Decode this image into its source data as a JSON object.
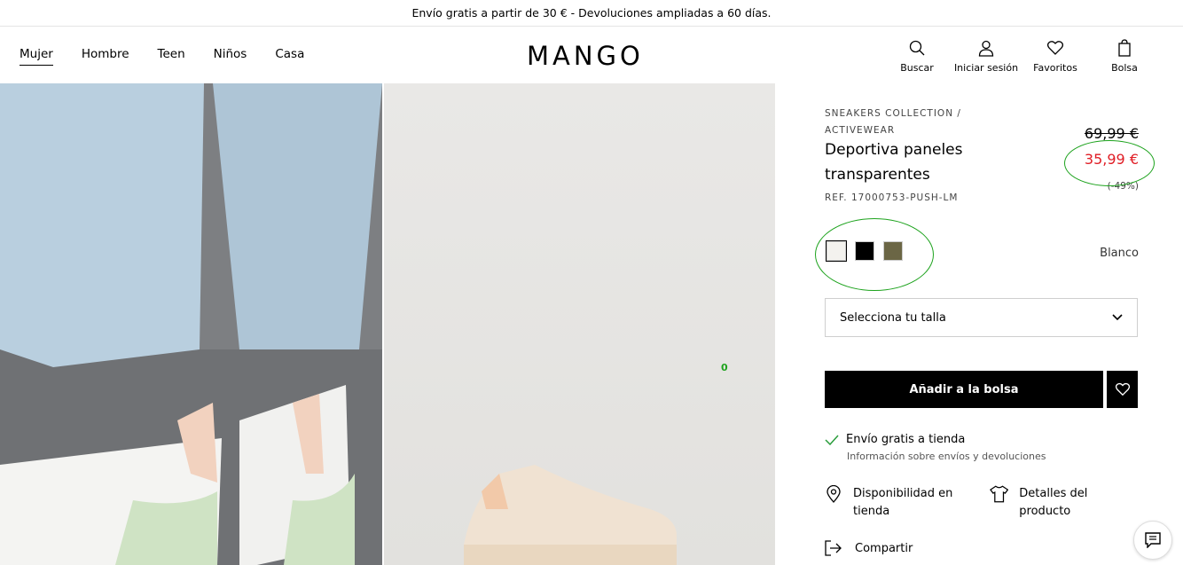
{
  "topbar": {
    "text": "Envío gratis a partir de 30 € - Devoluciones ampliadas a 60 días."
  },
  "nav": {
    "items": [
      "Mujer",
      "Hombre",
      "Teen",
      "Niños",
      "Casa"
    ]
  },
  "logo": "MANGO",
  "header_actions": {
    "search": "Buscar",
    "login": "Iniciar sesión",
    "favorites": "Favoritos",
    "bag": "Bolsa"
  },
  "product": {
    "collection": "SNEAKERS COLLECTION / ACTIVEWEAR",
    "title": "Deportiva paneles transparentes",
    "ref": "REF. 17000753-PUSH-LM",
    "price_old": "69,99 €",
    "price_new": "35,99 €",
    "discount": "(-49%)",
    "selected_color": "Blanco",
    "size_placeholder": "Selecciona tu talla",
    "add_to_bag": "Añadir a la bolsa",
    "shipping": "Envío gratis a tienda",
    "shipping_info": "Información sobre envíos y devoluciones",
    "availability": "Disponibilidad en tienda",
    "details": "Detalles del producto",
    "share": "Compartir"
  },
  "colors": {
    "swatches": [
      "#f3f2ee",
      "#000000",
      "#6b6645"
    ],
    "accent_price": "#e01d25",
    "annotation": "#1ea31e"
  },
  "overlay_counter": "0"
}
